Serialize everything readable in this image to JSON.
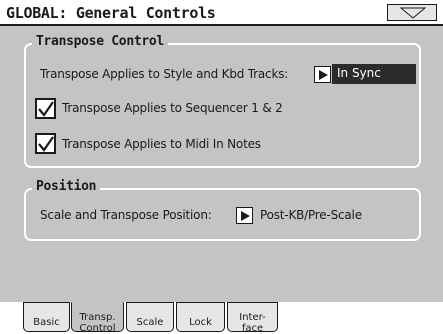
{
  "window": {
    "title": "GLOBAL: General Controls",
    "menu_icon": "triangle-down-icon"
  },
  "transpose_control": {
    "title": "Transpose Control",
    "applies_style_label": "Transpose Applies to Style and Kbd Tracks:",
    "applies_style_value": "In Sync",
    "sequencer_label": "Transpose Applies to Sequencer 1 & 2",
    "sequencer_checked": true,
    "midi_label": "Transpose Applies to Midi In Notes",
    "midi_checked": true
  },
  "position": {
    "title": "Position",
    "label": "Scale and Transpose Position:",
    "value": "Post-KB/Pre-Scale"
  },
  "tabs": [
    {
      "line1": "Basic",
      "line2": ""
    },
    {
      "line1": "Transp.",
      "line2": "Control",
      "active": true
    },
    {
      "line1": "Scale",
      "line2": ""
    },
    {
      "line1": "Lock",
      "line2": ""
    },
    {
      "line1": "Inter-",
      "line2": "face"
    }
  ],
  "colors": {
    "panel": "#c4c4c4",
    "value_box": "#2b2b2b",
    "border": "#ffffff"
  }
}
